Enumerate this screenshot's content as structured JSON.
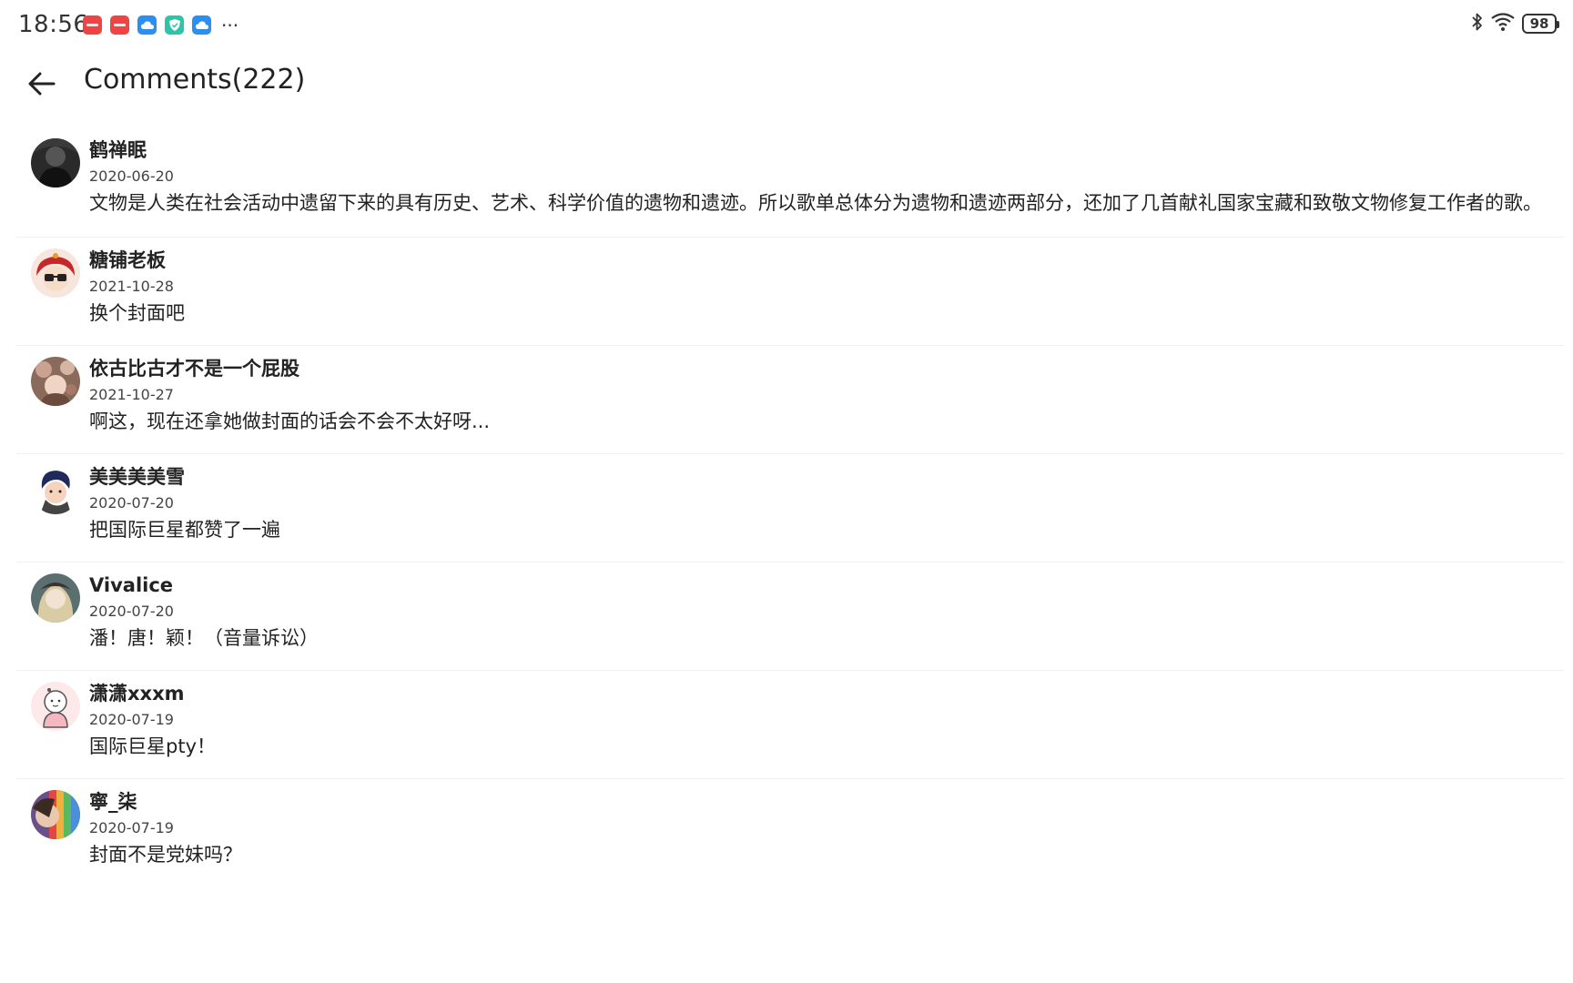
{
  "status_bar": {
    "time": "18:56",
    "more": "···",
    "battery": "98",
    "notification_colors": [
      "#ee4444",
      "#ee4444",
      "#2a8ff0",
      "#2ec4a8",
      "#2a8ff0"
    ]
  },
  "header": {
    "title": "Comments(222)"
  },
  "comments": [
    {
      "name": "鹤禅眠",
      "date": "2020-06-20",
      "text": "文物是人类在社会活动中遗留下来的具有历史、艺术、科学价值的遗物和遗迹。所以歌单总体分为遗物和遗迹两部分，还加了几首献礼国家宝藏和致敬文物修复工作者的歌。"
    },
    {
      "name": "糖铺老板",
      "date": "2021-10-28",
      "text": "换个封面吧"
    },
    {
      "name": "依古比古才不是一个屁股",
      "date": "2021-10-27",
      "text": "啊这，现在还拿她做封面的话会不会不太好呀..."
    },
    {
      "name": "美美美美雪",
      "date": "2020-07-20",
      "text": "把国际巨星都赞了一遍"
    },
    {
      "name": "Vivalice",
      "date": "2020-07-20",
      "text": "潘！唐！颖！（音量诉讼）"
    },
    {
      "name": "潇潇xxxm",
      "date": "2020-07-19",
      "text": "国际巨星pty！"
    },
    {
      "name": "寧_柒",
      "date": "2020-07-19",
      "text": "封面不是党妹吗？"
    }
  ]
}
